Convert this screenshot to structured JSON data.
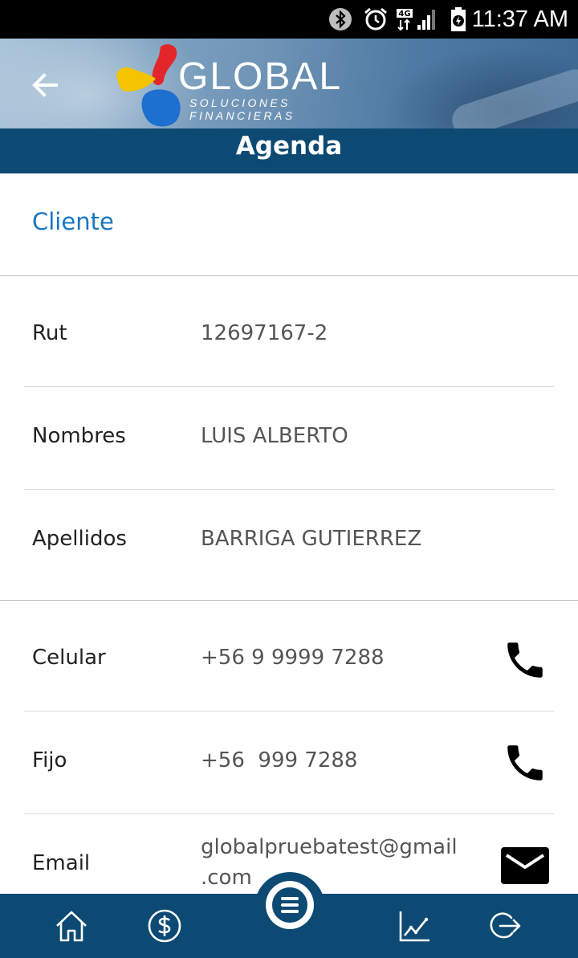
{
  "status_bar": {
    "time": "11:37 AM",
    "network": "4G",
    "icons": [
      "bluetooth-icon",
      "alarm-icon",
      "4g-signal-icon",
      "battery-charging-icon"
    ]
  },
  "header": {
    "logo_title": "GLOBAL",
    "logo_subtitle": "SOLUCIONES FINANCIERAS",
    "page_title": "Agenda"
  },
  "section": {
    "title": "Cliente"
  },
  "fields": {
    "rut": {
      "label": "Rut",
      "value": "12697167-2"
    },
    "nombres": {
      "label": "Nombres",
      "value": "LUIS ALBERTO"
    },
    "apellidos": {
      "label": "Apellidos",
      "value": "BARRIGA GUTIERREZ"
    },
    "celular": {
      "label": "Celular",
      "value": "+56 9 9999 7288"
    },
    "fijo": {
      "label": "Fijo",
      "value": "+56  999 7288"
    },
    "email": {
      "label": "Email",
      "value_line1": "globalpruebatest@gmail",
      "value_line2": ".com"
    }
  },
  "bottom_nav": {
    "items": [
      "home-icon",
      "money-icon",
      "menu-icon",
      "chart-icon",
      "logout-icon"
    ]
  },
  "colors": {
    "primary": "#0c4a73",
    "accent": "#1976c2",
    "logo_red": "#e3262a",
    "logo_yellow": "#f5c400",
    "logo_blue": "#1d6fd0"
  }
}
